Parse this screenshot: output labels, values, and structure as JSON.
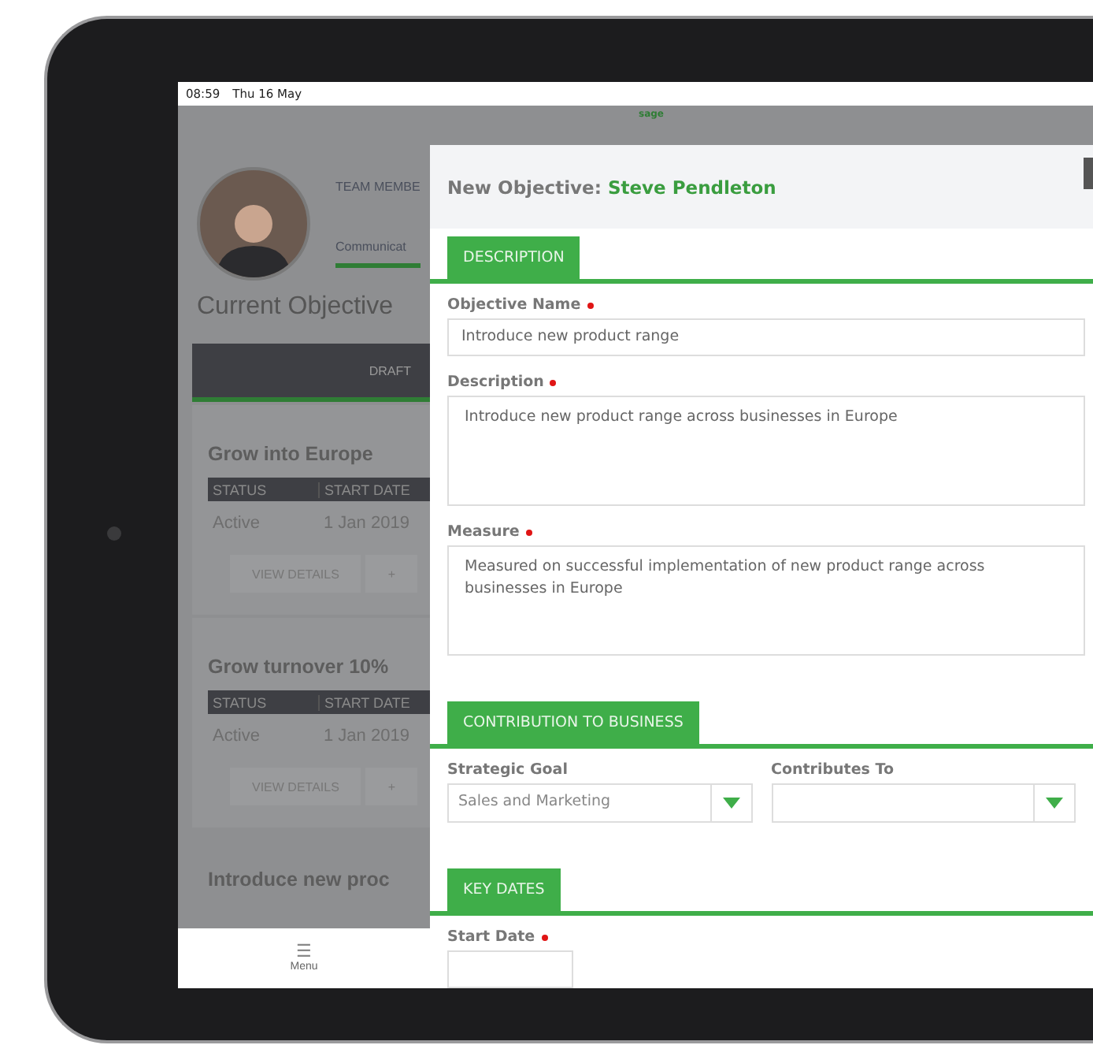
{
  "status_bar": {
    "time": "08:59",
    "date": "Thu 16 May"
  },
  "app_header": {
    "logo": "sage"
  },
  "profile": {
    "tabs": [
      {
        "label": "TEAM MEMBE",
        "selected": false
      },
      {
        "label": "Communicat",
        "selected": true
      }
    ]
  },
  "heading": "Current Objective",
  "status_tabs": [
    {
      "label": "DRAFT",
      "selected": true
    }
  ],
  "objectives": [
    {
      "title": "Grow into Europe",
      "columns": [
        "STATUS",
        "START DATE"
      ],
      "cells": [
        "Active",
        "1 Jan 2019"
      ],
      "buttons": [
        "VIEW DETAILS",
        "+"
      ]
    },
    {
      "title": "Grow turnover 10%",
      "columns": [
        "STATUS",
        "START DATE"
      ],
      "cells": [
        "Active",
        "1 Jan 2019"
      ],
      "buttons": [
        "VIEW DETAILS",
        "+"
      ]
    },
    {
      "title": "Introduce new proc"
    }
  ],
  "bottom_nav": [
    {
      "icon": "☰",
      "label": "Menu"
    }
  ],
  "modal": {
    "title": "New Objective:",
    "name": "Steve Pendleton",
    "sections": [
      {
        "tab": "DESCRIPTION",
        "fields": [
          {
            "kind": "input",
            "label": "Objective Name",
            "required": true,
            "value": "Introduce new product range"
          },
          {
            "kind": "textarea",
            "label": "Description",
            "required": true,
            "value": "Introduce new product range across businesses in Europe"
          },
          {
            "kind": "textarea",
            "label": "Measure",
            "required": true,
            "value": "Measured on successful implementation of new product range across businesses in Europe"
          }
        ]
      },
      {
        "tab": "CONTRIBUTION TO BUSINESS",
        "fields": [
          {
            "kind": "select",
            "label": "Strategic Goal",
            "required": false,
            "value": "Sales and Marketing"
          },
          {
            "kind": "select",
            "label": "Contributes To",
            "required": false
          }
        ]
      },
      {
        "tab": "KEY DATES",
        "fields": [
          {
            "kind": "date",
            "label": "Start Date",
            "required": true
          }
        ]
      }
    ]
  }
}
